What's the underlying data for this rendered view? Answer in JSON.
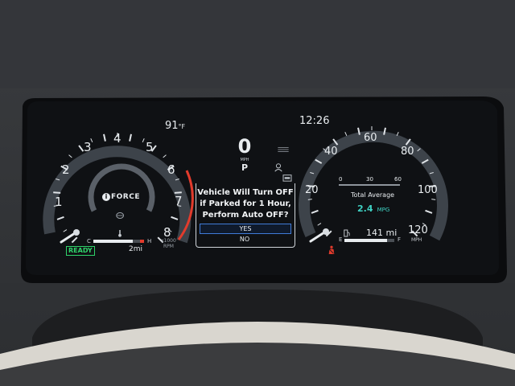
{
  "top_bar": {
    "outside_temp": "91",
    "temp_unit": "°F",
    "clock": "12:26"
  },
  "speed": {
    "value": "0",
    "unit": "MPH",
    "gear": "P"
  },
  "tachometer": {
    "ticks": [
      "1",
      "2",
      "3",
      "4",
      "5",
      "6",
      "7",
      "8"
    ],
    "unit_top": "x1000",
    "unit_bottom": "RPM",
    "logo": "FORCE"
  },
  "temp_gauge": {
    "cold": "C",
    "hot": "H",
    "level": 0.78
  },
  "status": {
    "ready": "READY",
    "trip": "2mi"
  },
  "dialog": {
    "lines": [
      "Vehicle Will Turn OFF",
      "if Parked for 1 Hour,",
      "Perform Auto OFF?"
    ],
    "yes": "YES",
    "no": "NO"
  },
  "speedometer": {
    "ticks": [
      "20",
      "40",
      "60",
      "80",
      "100",
      "120"
    ],
    "unit": "MPH"
  },
  "fuel_economy": {
    "scale": [
      "0",
      "30",
      "60"
    ],
    "label": "Total Average",
    "value": "2.4",
    "unit": "MPG"
  },
  "fuel": {
    "range": "141 mi",
    "empty": "E",
    "full": "F",
    "level": 0.85
  },
  "colors": {
    "accent_green": "#2fd36a",
    "redline": "#e23b2c",
    "dialog_border": "#3f7bd8",
    "mpg_text": "#3fd0c2"
  },
  "icons": [
    "thermometer-icon",
    "fuel-pump-icon",
    "seatbelt-warning-icon",
    "trac-off-icon",
    "auto-high-beam-icon",
    "lane-assist-icon"
  ]
}
